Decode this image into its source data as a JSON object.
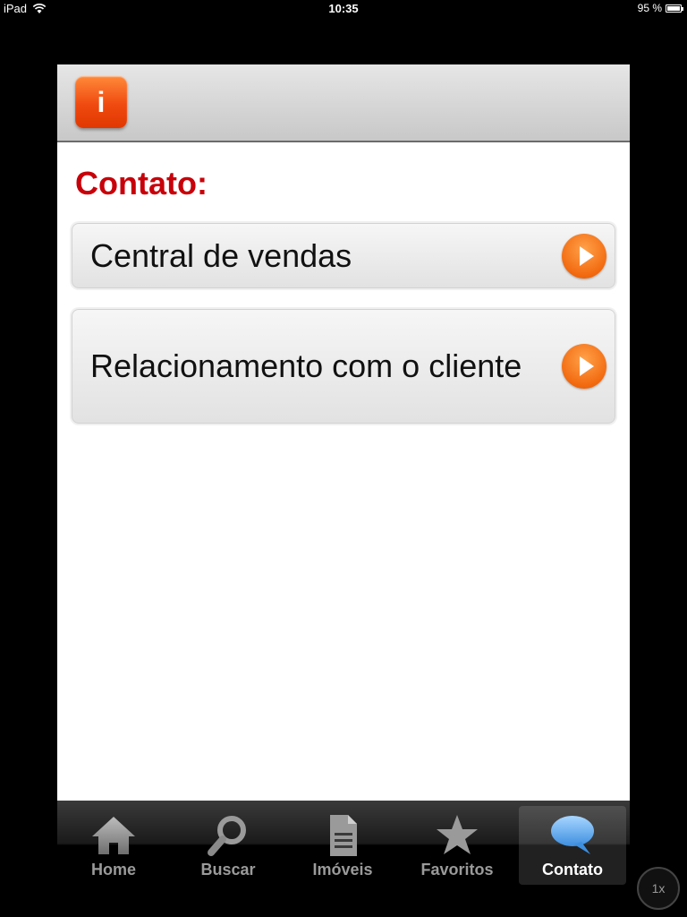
{
  "status_bar": {
    "device": "iPad",
    "time": "10:35",
    "battery": "95 %",
    "battery_level": 0.95
  },
  "header": {
    "info_icon_glyph": "i"
  },
  "main": {
    "section_title": "Contato:",
    "items": [
      {
        "label": "Central de vendas"
      },
      {
        "label": "Relacionamento com o cliente"
      }
    ]
  },
  "tabs": [
    {
      "label": "Home",
      "icon": "home-icon"
    },
    {
      "label": "Buscar",
      "icon": "search-icon"
    },
    {
      "label": "Imóveis",
      "icon": "document-icon"
    },
    {
      "label": "Favoritos",
      "icon": "star-icon"
    },
    {
      "label": "Contato",
      "icon": "chat-bubble-icon",
      "active": true
    }
  ],
  "zoom": {
    "label": "1x"
  },
  "colors": {
    "accent_orange": "#f26a10",
    "title_red": "#c8000a",
    "chat_blue": "#5aa8f0"
  }
}
